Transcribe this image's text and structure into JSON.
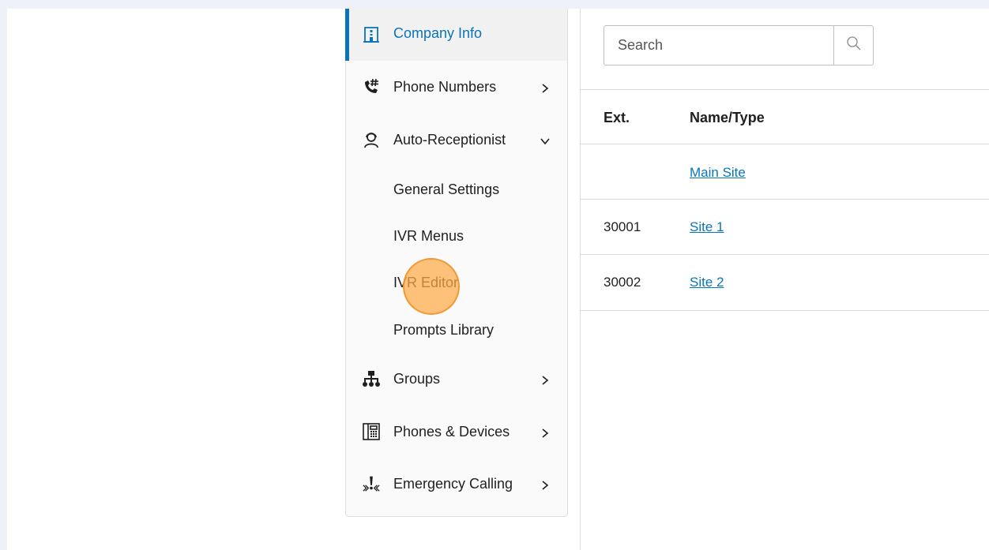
{
  "sidebar": {
    "items": [
      {
        "label": "Company Info",
        "icon": "building-icon"
      },
      {
        "label": "Phone Numbers",
        "icon": "phone-hash-icon"
      },
      {
        "label": "Auto-Receptionist",
        "icon": "receptionist-icon"
      },
      {
        "label": "Groups",
        "icon": "org-chart-icon"
      },
      {
        "label": "Phones & Devices",
        "icon": "desk-phone-icon"
      },
      {
        "label": "Emergency Calling",
        "icon": "emergency-icon"
      }
    ],
    "sub_items": [
      {
        "label": "General Settings"
      },
      {
        "label": "IVR Menus"
      },
      {
        "label": "IVR Editor"
      },
      {
        "label": "Prompts Library"
      }
    ]
  },
  "search": {
    "placeholder": "Search"
  },
  "table": {
    "headers": {
      "ext": "Ext.",
      "name": "Name/Type"
    },
    "rows": [
      {
        "ext": "",
        "name": "Main Site"
      },
      {
        "ext": "30001",
        "name": "Site 1"
      },
      {
        "ext": "30002",
        "name": "Site 2"
      }
    ]
  },
  "colors": {
    "accent": "#0b74b8",
    "click_indicator": "#ffaa46"
  }
}
